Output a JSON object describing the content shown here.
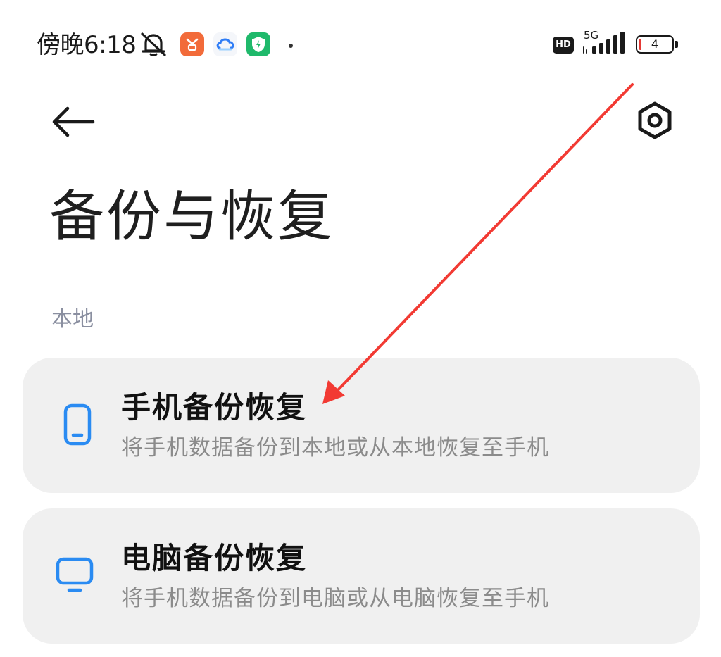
{
  "status_bar": {
    "time": "傍晚6:18",
    "network_type": "5G",
    "hd_label": "HD",
    "battery_level": "4",
    "icons": [
      "mute-bell-icon",
      "app-notification-icon",
      "cloud-app-icon",
      "shield-app-icon"
    ],
    "app_colors": {
      "orange": "#f26b3a",
      "cloud": "#2f7df6",
      "shield": "#1fb96b"
    }
  },
  "header": {
    "back_icon": "back-arrow-icon",
    "settings_icon": "settings-hexagon-icon",
    "title": "备份与恢复"
  },
  "section": {
    "label": "本地"
  },
  "items": [
    {
      "icon": "phone-icon",
      "title": "手机备份恢复",
      "subtitle": "将手机数据备份到本地或从本地恢复至手机"
    },
    {
      "icon": "monitor-icon",
      "title": "电脑备份恢复",
      "subtitle": "将手机数据备份到电脑或从电脑恢复至手机"
    }
  ],
  "colors": {
    "accent_icon": "#2a8bf2",
    "card_background": "#f0f0f0",
    "annotation_arrow": "#f23a33"
  }
}
